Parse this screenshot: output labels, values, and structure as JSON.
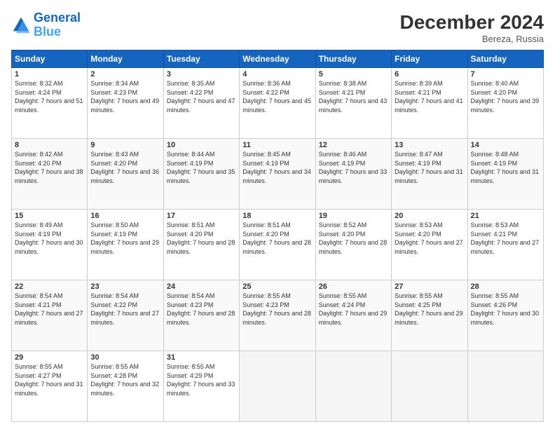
{
  "header": {
    "logo_line1": "General",
    "logo_line2": "Blue",
    "month_title": "December 2024",
    "location": "Bereza, Russia"
  },
  "calendar": {
    "days_of_week": [
      "Sunday",
      "Monday",
      "Tuesday",
      "Wednesday",
      "Thursday",
      "Friday",
      "Saturday"
    ],
    "weeks": [
      [
        {
          "day": "1",
          "sunrise": "8:32 AM",
          "sunset": "4:24 PM",
          "daylight": "7 hours and 51 minutes."
        },
        {
          "day": "2",
          "sunrise": "8:34 AM",
          "sunset": "4:23 PM",
          "daylight": "7 hours and 49 minutes."
        },
        {
          "day": "3",
          "sunrise": "8:35 AM",
          "sunset": "4:22 PM",
          "daylight": "7 hours and 47 minutes."
        },
        {
          "day": "4",
          "sunrise": "8:36 AM",
          "sunset": "4:22 PM",
          "daylight": "7 hours and 45 minutes."
        },
        {
          "day": "5",
          "sunrise": "8:38 AM",
          "sunset": "4:21 PM",
          "daylight": "7 hours and 43 minutes."
        },
        {
          "day": "6",
          "sunrise": "8:39 AM",
          "sunset": "4:21 PM",
          "daylight": "7 hours and 41 minutes."
        },
        {
          "day": "7",
          "sunrise": "8:40 AM",
          "sunset": "4:20 PM",
          "daylight": "7 hours and 39 minutes."
        }
      ],
      [
        {
          "day": "8",
          "sunrise": "8:42 AM",
          "sunset": "4:20 PM",
          "daylight": "7 hours and 38 minutes."
        },
        {
          "day": "9",
          "sunrise": "8:43 AM",
          "sunset": "4:20 PM",
          "daylight": "7 hours and 36 minutes."
        },
        {
          "day": "10",
          "sunrise": "8:44 AM",
          "sunset": "4:19 PM",
          "daylight": "7 hours and 35 minutes."
        },
        {
          "day": "11",
          "sunrise": "8:45 AM",
          "sunset": "4:19 PM",
          "daylight": "7 hours and 34 minutes."
        },
        {
          "day": "12",
          "sunrise": "8:46 AM",
          "sunset": "4:19 PM",
          "daylight": "7 hours and 33 minutes."
        },
        {
          "day": "13",
          "sunrise": "8:47 AM",
          "sunset": "4:19 PM",
          "daylight": "7 hours and 31 minutes."
        },
        {
          "day": "14",
          "sunrise": "8:48 AM",
          "sunset": "4:19 PM",
          "daylight": "7 hours and 31 minutes."
        }
      ],
      [
        {
          "day": "15",
          "sunrise": "8:49 AM",
          "sunset": "4:19 PM",
          "daylight": "7 hours and 30 minutes."
        },
        {
          "day": "16",
          "sunrise": "8:50 AM",
          "sunset": "4:19 PM",
          "daylight": "7 hours and 29 minutes."
        },
        {
          "day": "17",
          "sunrise": "8:51 AM",
          "sunset": "4:20 PM",
          "daylight": "7 hours and 28 minutes."
        },
        {
          "day": "18",
          "sunrise": "8:51 AM",
          "sunset": "4:20 PM",
          "daylight": "7 hours and 28 minutes."
        },
        {
          "day": "19",
          "sunrise": "8:52 AM",
          "sunset": "4:20 PM",
          "daylight": "7 hours and 28 minutes."
        },
        {
          "day": "20",
          "sunrise": "8:53 AM",
          "sunset": "4:20 PM",
          "daylight": "7 hours and 27 minutes."
        },
        {
          "day": "21",
          "sunrise": "8:53 AM",
          "sunset": "4:21 PM",
          "daylight": "7 hours and 27 minutes."
        }
      ],
      [
        {
          "day": "22",
          "sunrise": "8:54 AM",
          "sunset": "4:21 PM",
          "daylight": "7 hours and 27 minutes."
        },
        {
          "day": "23",
          "sunrise": "8:54 AM",
          "sunset": "4:22 PM",
          "daylight": "7 hours and 27 minutes."
        },
        {
          "day": "24",
          "sunrise": "8:54 AM",
          "sunset": "4:23 PM",
          "daylight": "7 hours and 28 minutes."
        },
        {
          "day": "25",
          "sunrise": "8:55 AM",
          "sunset": "4:23 PM",
          "daylight": "7 hours and 28 minutes."
        },
        {
          "day": "26",
          "sunrise": "8:55 AM",
          "sunset": "4:24 PM",
          "daylight": "7 hours and 29 minutes."
        },
        {
          "day": "27",
          "sunrise": "8:55 AM",
          "sunset": "4:25 PM",
          "daylight": "7 hours and 29 minutes."
        },
        {
          "day": "28",
          "sunrise": "8:55 AM",
          "sunset": "4:26 PM",
          "daylight": "7 hours and 30 minutes."
        }
      ],
      [
        {
          "day": "29",
          "sunrise": "8:55 AM",
          "sunset": "4:27 PM",
          "daylight": "7 hours and 31 minutes."
        },
        {
          "day": "30",
          "sunrise": "8:55 AM",
          "sunset": "4:28 PM",
          "daylight": "7 hours and 32 minutes."
        },
        {
          "day": "31",
          "sunrise": "8:55 AM",
          "sunset": "4:29 PM",
          "daylight": "7 hours and 33 minutes."
        },
        null,
        null,
        null,
        null
      ]
    ]
  }
}
